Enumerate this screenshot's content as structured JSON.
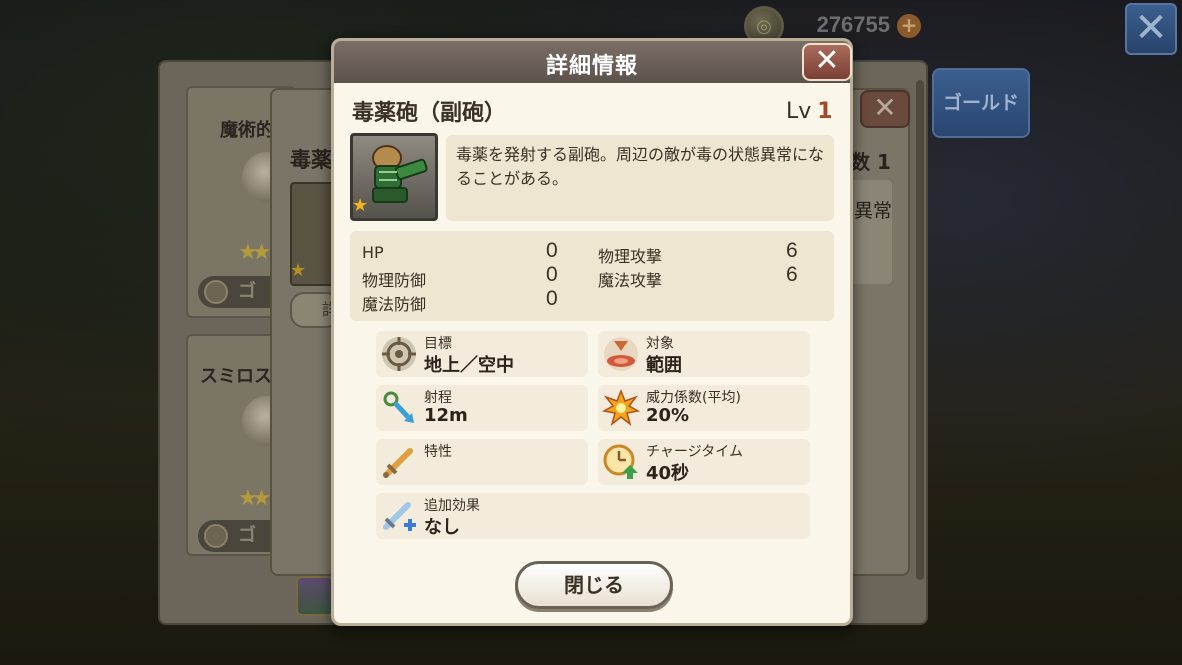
{
  "top_bar": {
    "gold_amount": "276755",
    "gold_icon": "gold-coin-icon",
    "plus_label": "+",
    "close_label": "✕"
  },
  "background": {
    "card1_title": "魔術的",
    "card1_footer": "ゴ",
    "card2_title": "スミロス",
    "card2_footer": "ゴ",
    "mid_title": "毒薬",
    "mid_button": "詳",
    "mid_right_count": "数 1",
    "mid_right_text": "異常",
    "gold_tab": "ゴールド"
  },
  "modal": {
    "title": "詳細情報",
    "close_label": "✕",
    "item_name": "毒薬砲（副砲）",
    "level_label": "Lv",
    "level_value": "1",
    "description": "毒薬を発射する副砲。周辺の敵が毒の状態異常になることがある。",
    "stats": [
      {
        "label": "HP",
        "value": "0"
      },
      {
        "label": "物理防御",
        "value": "0"
      },
      {
        "label": "魔法防御",
        "value": "0"
      },
      {
        "label": "物理攻撃",
        "value": "6"
      },
      {
        "label": "魔法攻撃",
        "value": "6"
      }
    ],
    "info": {
      "target": {
        "label": "目標",
        "value": "地上／空中",
        "icon": "crosshair-icon"
      },
      "scope": {
        "label": "対象",
        "value": "範囲",
        "icon": "area-target-icon"
      },
      "range": {
        "label": "射程",
        "value": "12m",
        "icon": "range-icon"
      },
      "power": {
        "label": "威力係数(平均)",
        "value": "20%",
        "icon": "explosion-icon"
      },
      "trait": {
        "label": "特性",
        "value": "",
        "icon": "sword-icon"
      },
      "charge": {
        "label": "チャージタイム",
        "value": "40秒",
        "icon": "clock-up-icon"
      },
      "extra": {
        "label": "追加効果",
        "value": "なし",
        "icon": "sword-plus-icon"
      }
    },
    "close_button": "閉じる"
  },
  "colors": {
    "modal_bg": "#fbf6ea",
    "header": "#6b5f58",
    "close_red": "#8a4a3c",
    "level_accent": "#a04a2a",
    "star": "#f2b51c"
  }
}
